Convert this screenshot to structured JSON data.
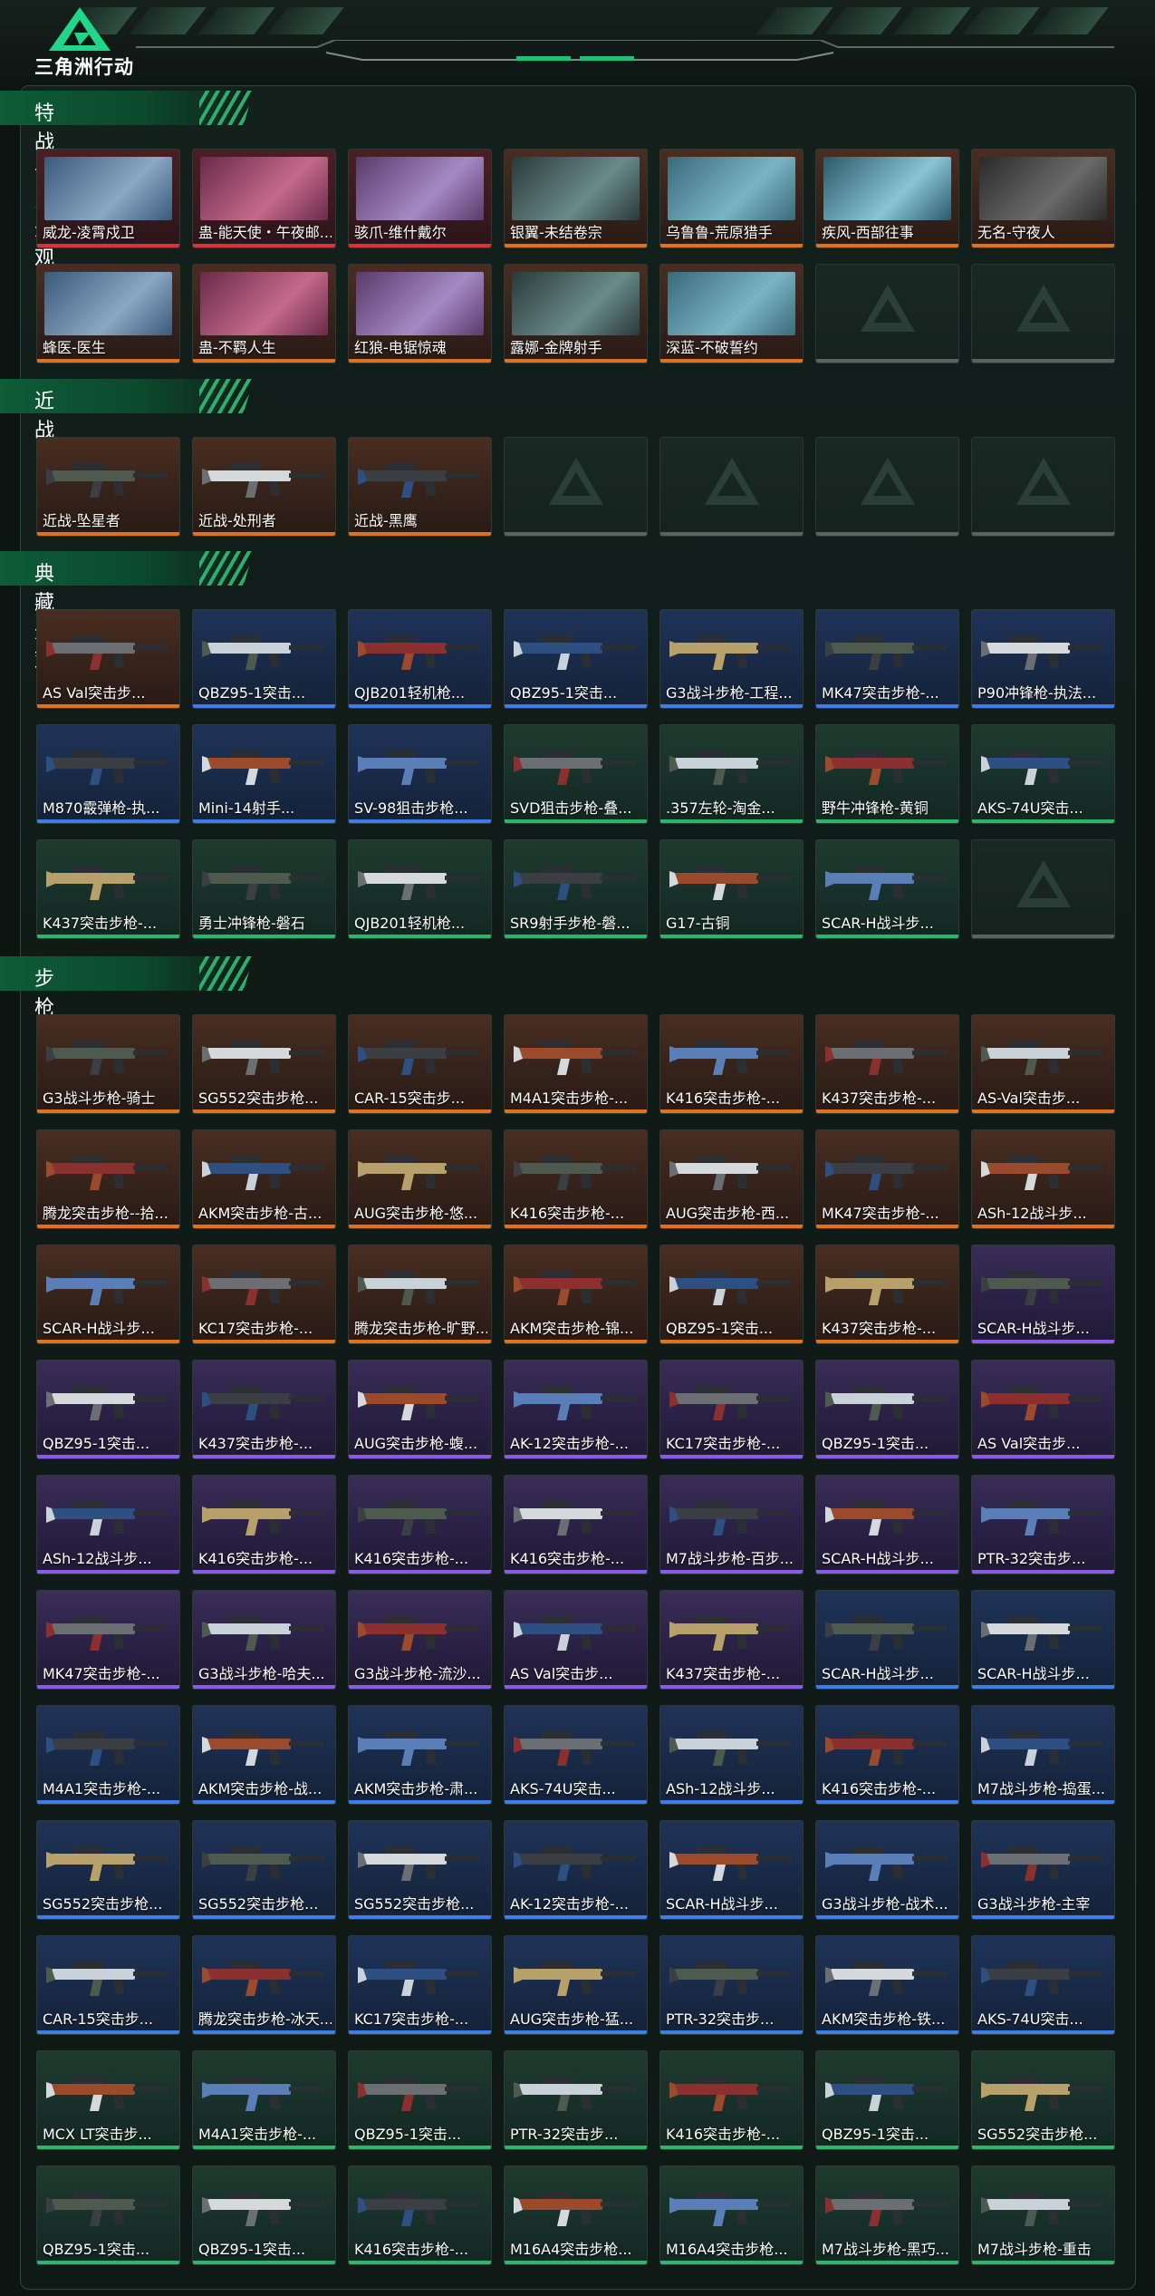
{
  "header": {
    "title": "三角洲行动",
    "logo": "delta-logo-icon"
  },
  "colors": {
    "orange": "#e0711e",
    "purple": "#8a5ce6",
    "blue": "#3c7de8",
    "green": "#2fb56a",
    "red": "#d8343a",
    "accent": "#1f8a56"
  },
  "sections": [
    {
      "title": "特战干员外观",
      "items": [
        {
          "label": "威龙-凌霄戍卫",
          "rarity": "red"
        },
        {
          "label": "蛊-能天使・午夜邮...",
          "rarity": "red"
        },
        {
          "label": "骇爪-维什戴尔",
          "rarity": "red"
        },
        {
          "label": "银翼-未结卷宗",
          "rarity": "orange"
        },
        {
          "label": "乌鲁鲁-荒原猎手",
          "rarity": "orange"
        },
        {
          "label": "疾风-西部往事",
          "rarity": "orange"
        },
        {
          "label": "无名-守夜人",
          "rarity": "orange"
        },
        {
          "label": "蜂医-医生",
          "rarity": "orange"
        },
        {
          "label": "蛊-不羁人生",
          "rarity": "orange"
        },
        {
          "label": "红狼-电锯惊魂",
          "rarity": "orange"
        },
        {
          "label": "露娜-金牌射手",
          "rarity": "orange"
        },
        {
          "label": "深蓝-不破誓约",
          "rarity": "orange"
        },
        {
          "label": "",
          "rarity": "empty"
        },
        {
          "label": "",
          "rarity": "empty"
        }
      ]
    },
    {
      "title": "近战",
      "items": [
        {
          "label": "近战-坠星者",
          "rarity": "orange"
        },
        {
          "label": "近战-处刑者",
          "rarity": "orange"
        },
        {
          "label": "近战-黑鹰",
          "rarity": "orange"
        },
        {
          "label": "",
          "rarity": "empty"
        },
        {
          "label": "",
          "rarity": "empty"
        },
        {
          "label": "",
          "rarity": "empty"
        },
        {
          "label": "",
          "rarity": "empty"
        }
      ]
    },
    {
      "title": "典藏外观",
      "items": [
        {
          "label": "AS Val突击步...",
          "rarity": "orange"
        },
        {
          "label": "QBZ95-1突击...",
          "rarity": "blue"
        },
        {
          "label": "QJB201轻机枪...",
          "rarity": "blue"
        },
        {
          "label": "QBZ95-1突击...",
          "rarity": "blue"
        },
        {
          "label": "G3战斗步枪-工程...",
          "rarity": "blue"
        },
        {
          "label": "MK47突击步枪-...",
          "rarity": "blue"
        },
        {
          "label": "P90冲锋枪-执法...",
          "rarity": "blue"
        },
        {
          "label": "M870霰弹枪-执...",
          "rarity": "blue"
        },
        {
          "label": "Mini-14射手...",
          "rarity": "blue"
        },
        {
          "label": "SV-98狙击步枪...",
          "rarity": "blue"
        },
        {
          "label": "SVD狙击步枪-叠...",
          "rarity": "green"
        },
        {
          "label": ".357左轮-淘金...",
          "rarity": "green"
        },
        {
          "label": "野牛冲锋枪-黄铜",
          "rarity": "green"
        },
        {
          "label": "AKS-74U突击...",
          "rarity": "green"
        },
        {
          "label": "K437突击步枪-...",
          "rarity": "green"
        },
        {
          "label": "勇士冲锋枪-磐石",
          "rarity": "green"
        },
        {
          "label": "QJB201轻机枪...",
          "rarity": "green"
        },
        {
          "label": "SR9射手步枪-磐...",
          "rarity": "green"
        },
        {
          "label": "G17-古铜",
          "rarity": "green"
        },
        {
          "label": "SCAR-H战斗步...",
          "rarity": "green"
        },
        {
          "label": "",
          "rarity": "empty"
        }
      ]
    },
    {
      "title": "步枪",
      "items": [
        {
          "label": "G3战斗步枪-骑士",
          "rarity": "orange"
        },
        {
          "label": "SG552突击步枪...",
          "rarity": "orange"
        },
        {
          "label": "CAR-15突击步...",
          "rarity": "orange"
        },
        {
          "label": "M4A1突击步枪-...",
          "rarity": "orange"
        },
        {
          "label": "K416突击步枪-...",
          "rarity": "orange"
        },
        {
          "label": "K437突击步枪-...",
          "rarity": "orange"
        },
        {
          "label": "AS-Val突击步...",
          "rarity": "orange"
        },
        {
          "label": "腾龙突击步枪--拾...",
          "rarity": "orange"
        },
        {
          "label": "AKM突击步枪-古...",
          "rarity": "orange"
        },
        {
          "label": "AUG突击步枪-悠...",
          "rarity": "orange"
        },
        {
          "label": "K416突击步枪-...",
          "rarity": "orange"
        },
        {
          "label": "AUG突击步枪-西...",
          "rarity": "orange"
        },
        {
          "label": "MK47突击步枪-...",
          "rarity": "orange"
        },
        {
          "label": "ASh-12战斗步...",
          "rarity": "orange"
        },
        {
          "label": "SCAR-H战斗步...",
          "rarity": "orange"
        },
        {
          "label": "KC17突击步枪-...",
          "rarity": "orange"
        },
        {
          "label": "腾龙突击步枪-旷野...",
          "rarity": "orange"
        },
        {
          "label": "AKM突击步枪-锦...",
          "rarity": "orange"
        },
        {
          "label": "QBZ95-1突击...",
          "rarity": "orange"
        },
        {
          "label": "K437突击步枪-...",
          "rarity": "orange"
        },
        {
          "label": "SCAR-H战斗步...",
          "rarity": "purple"
        },
        {
          "label": "QBZ95-1突击...",
          "rarity": "purple"
        },
        {
          "label": "K437突击步枪-...",
          "rarity": "purple"
        },
        {
          "label": "AUG突击步枪-蝮...",
          "rarity": "purple"
        },
        {
          "label": "AK-12突击步枪-...",
          "rarity": "purple"
        },
        {
          "label": "KC17突击步枪-...",
          "rarity": "purple"
        },
        {
          "label": "QBZ95-1突击...",
          "rarity": "purple"
        },
        {
          "label": "AS Val突击步...",
          "rarity": "purple"
        },
        {
          "label": "ASh-12战斗步...",
          "rarity": "purple"
        },
        {
          "label": "K416突击步枪-...",
          "rarity": "purple"
        },
        {
          "label": "K416突击步枪-...",
          "rarity": "purple"
        },
        {
          "label": "K416突击步枪-...",
          "rarity": "purple"
        },
        {
          "label": "M7战斗步枪-百步...",
          "rarity": "purple"
        },
        {
          "label": "SCAR-H战斗步...",
          "rarity": "purple"
        },
        {
          "label": "PTR-32突击步...",
          "rarity": "purple"
        },
        {
          "label": "MK47突击步枪-...",
          "rarity": "purple"
        },
        {
          "label": "G3战斗步枪-哈夫...",
          "rarity": "purple"
        },
        {
          "label": "G3战斗步枪-流沙...",
          "rarity": "purple"
        },
        {
          "label": "AS Val突击步...",
          "rarity": "purple"
        },
        {
          "label": "K437突击步枪-...",
          "rarity": "purple"
        },
        {
          "label": "SCAR-H战斗步...",
          "rarity": "blue"
        },
        {
          "label": "SCAR-H战斗步...",
          "rarity": "blue"
        },
        {
          "label": "M4A1突击步枪-...",
          "rarity": "blue"
        },
        {
          "label": "AKM突击步枪-战...",
          "rarity": "blue"
        },
        {
          "label": "AKM突击步枪-肃...",
          "rarity": "blue"
        },
        {
          "label": "AKS-74U突击...",
          "rarity": "blue"
        },
        {
          "label": "ASh-12战斗步...",
          "rarity": "blue"
        },
        {
          "label": "K416突击步枪-...",
          "rarity": "blue"
        },
        {
          "label": "M7战斗步枪-捣蛋...",
          "rarity": "blue"
        },
        {
          "label": "SG552突击步枪...",
          "rarity": "blue"
        },
        {
          "label": "SG552突击步枪...",
          "rarity": "blue"
        },
        {
          "label": "SG552突击步枪...",
          "rarity": "blue"
        },
        {
          "label": "AK-12突击步枪-...",
          "rarity": "blue"
        },
        {
          "label": "SCAR-H战斗步...",
          "rarity": "blue"
        },
        {
          "label": "G3战斗步枪-战术...",
          "rarity": "blue"
        },
        {
          "label": "G3战斗步枪-主宰",
          "rarity": "blue"
        },
        {
          "label": "CAR-15突击步...",
          "rarity": "blue"
        },
        {
          "label": "腾龙突击步枪-冰天...",
          "rarity": "blue"
        },
        {
          "label": "KC17突击步枪-...",
          "rarity": "blue"
        },
        {
          "label": "AUG突击步枪-猛...",
          "rarity": "blue"
        },
        {
          "label": "PTR-32突击步...",
          "rarity": "blue"
        },
        {
          "label": "AKM突击步枪-铁...",
          "rarity": "blue"
        },
        {
          "label": "AKS-74U突击...",
          "rarity": "blue"
        },
        {
          "label": "MCX LT突击步...",
          "rarity": "green"
        },
        {
          "label": "M4A1突击步枪-...",
          "rarity": "green"
        },
        {
          "label": "QBZ95-1突击...",
          "rarity": "green"
        },
        {
          "label": "PTR-32突击步...",
          "rarity": "green"
        },
        {
          "label": "K416突击步枪-...",
          "rarity": "green"
        },
        {
          "label": "QBZ95-1突击...",
          "rarity": "green"
        },
        {
          "label": "SG552突击步枪...",
          "rarity": "green"
        },
        {
          "label": "QBZ95-1突击...",
          "rarity": "green"
        },
        {
          "label": "QBZ95-1突击...",
          "rarity": "green"
        },
        {
          "label": "K416突击步枪-...",
          "rarity": "green"
        },
        {
          "label": "M16A4突击步枪...",
          "rarity": "green"
        },
        {
          "label": "M16A4突击步枪...",
          "rarity": "green"
        },
        {
          "label": "M7战斗步枪-黑巧...",
          "rarity": "green"
        },
        {
          "label": "M7战斗步枪-重击",
          "rarity": "green"
        }
      ]
    }
  ]
}
